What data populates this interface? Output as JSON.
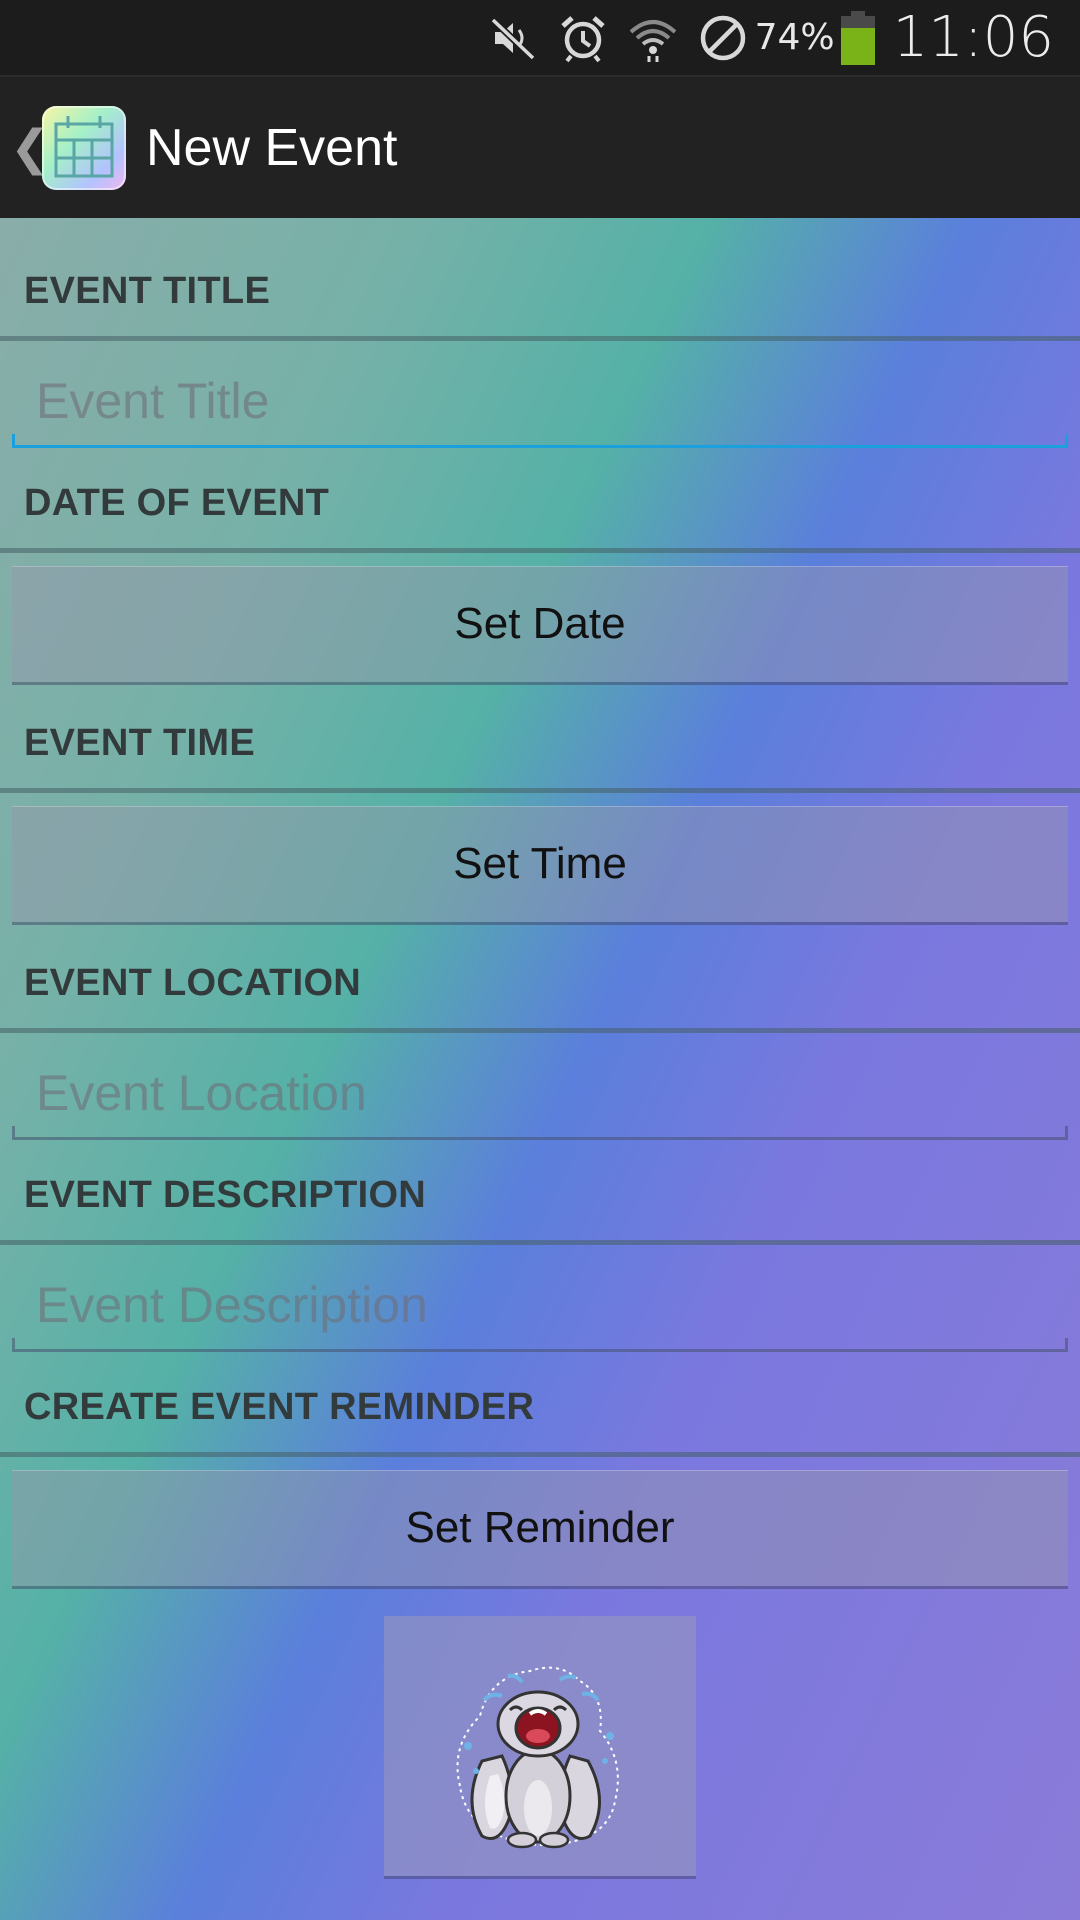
{
  "status_bar": {
    "battery_percent": "74%",
    "battery_level": 0.74,
    "time": "11:06",
    "icons": [
      "mute-icon",
      "alarm-icon",
      "wifi-icon",
      "blocked-icon"
    ],
    "battery_color": "#7ab317"
  },
  "action_bar": {
    "back_glyph": "❮",
    "title": "New Event",
    "app_icon": "calendar-icon"
  },
  "form": {
    "title_label": "EVENT TITLE",
    "title_placeholder": "Event Title",
    "date_label": "DATE OF EVENT",
    "date_button": "Set Date",
    "time_label": "EVENT TIME",
    "time_button": "Set Time",
    "location_label": "EVENT LOCATION",
    "location_placeholder": "Event Location",
    "description_label": "EVENT DESCRIPTION",
    "description_placeholder": "Event Description",
    "reminder_label": "CREATE EVENT REMINDER",
    "reminder_button": "Set Reminder",
    "image_button_icon": "crying-bunny-icon"
  },
  "colors": {
    "focus_underline": "#1aa0dd",
    "action_bar": "#222222"
  }
}
